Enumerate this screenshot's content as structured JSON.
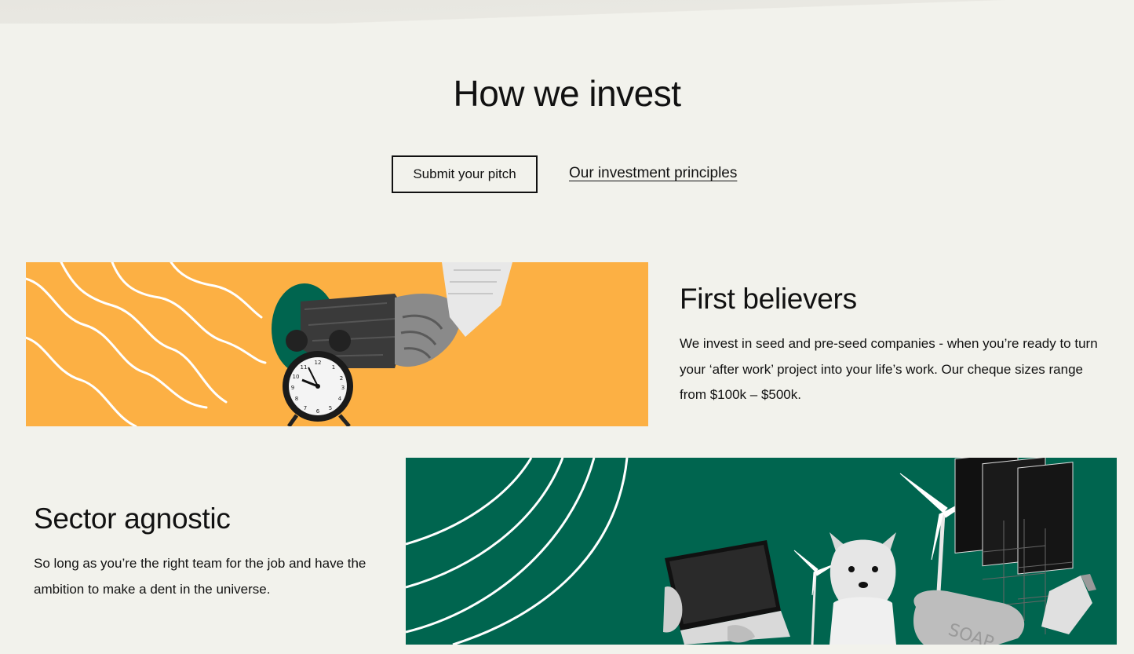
{
  "section": {
    "title": "How we invest"
  },
  "actions": {
    "submit_pitch_label": "Submit your pitch",
    "principles_link_label": "Our investment principles"
  },
  "features": {
    "first_believers": {
      "heading": "First believers",
      "body": "We invest in seed and pre-seed companies - when you’re ready to turn your ‘after work’ project into your life’s work. Our cheque sizes range from $100k – $500k.",
      "illustration_icons": [
        "handshake-icon",
        "alarm-clock-icon"
      ],
      "background_color": "#fcb044"
    },
    "sector_agnostic": {
      "heading": "Sector agnostic",
      "body": "So long as you’re the right team for the job and have the ambition to make a dent in the universe.",
      "illustration_icons": [
        "laptop-icon",
        "wind-turbine-icon",
        "corgi-dog-icon",
        "solar-panel-icon",
        "soap-bar-icon"
      ],
      "illustration_text": "SOAP",
      "background_color": "#00654f"
    }
  },
  "colors": {
    "page_background": "#f2f2ec",
    "text": "#111111",
    "accent_yellow": "#fcb044",
    "accent_green": "#00654f"
  }
}
